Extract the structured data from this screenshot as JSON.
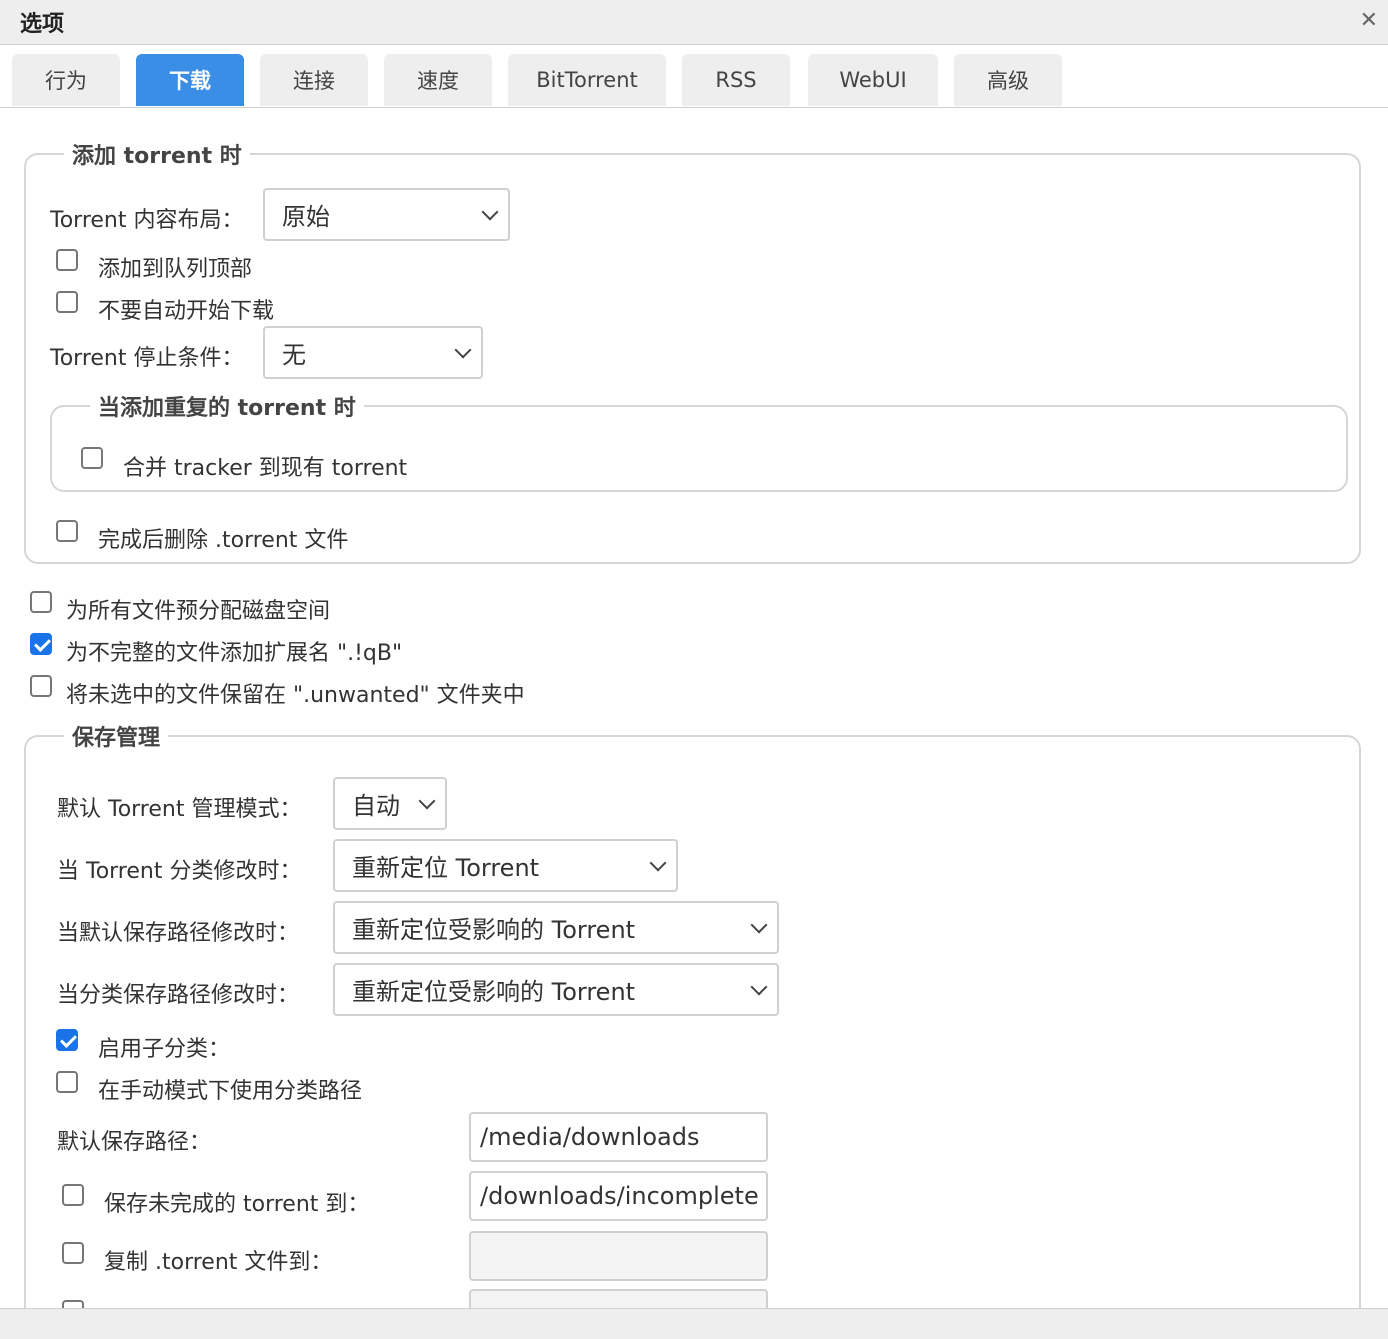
{
  "window": {
    "title": "选项",
    "close_icon": "close-icon"
  },
  "tabs": [
    "行为",
    "下载",
    "连接",
    "速度",
    "BitTorrent",
    "RSS",
    "WebUI",
    "高级"
  ],
  "active_tab": "下载",
  "add_torrent": {
    "legend": "添加 torrent 时",
    "content_layout_label": "Torrent 内容布局：",
    "content_layout_value": "原始",
    "add_to_top_label": "添加到队列顶部",
    "add_to_top_checked": false,
    "dont_start_label": "不要自动开始下载",
    "dont_start_checked": false,
    "stop_condition_label": "Torrent 停止条件：",
    "stop_condition_value": "无",
    "duplicate": {
      "legend": "当添加重复的 torrent 时",
      "merge_trackers_label": "合并 tracker 到现有 torrent",
      "merge_trackers_checked": false
    },
    "delete_torrent_file_label": "完成后删除 .torrent 文件",
    "delete_torrent_file_checked": false
  },
  "preallocate_label": "为所有文件预分配磁盘空间",
  "preallocate_checked": false,
  "append_qb_label": "为不完整的文件添加扩展名 \".!qB\"",
  "append_qb_checked": true,
  "unwanted_folder_label": "将未选中的文件保留在 \".unwanted\" 文件夹中",
  "unwanted_folder_checked": false,
  "save_management": {
    "legend": "保存管理",
    "default_mode_label": "默认 Torrent 管理模式：",
    "default_mode_value": "自动",
    "category_changed_label": "当 Torrent 分类修改时：",
    "category_changed_value": "重新定位 Torrent",
    "default_path_changed_label": "当默认保存路径修改时：",
    "default_path_changed_value": "重新定位受影响的 Torrent",
    "category_path_changed_label": "当分类保存路径修改时：",
    "category_path_changed_value": "重新定位受影响的 Torrent",
    "subcategories_label": "启用子分类：",
    "subcategories_checked": true,
    "manual_category_path_label": "在手动模式下使用分类路径",
    "manual_category_path_checked": false,
    "default_save_path_label": "默认保存路径：",
    "default_save_path_value": "/media/downloads",
    "incomplete_label": "保存未完成的 torrent 到：",
    "incomplete_checked": false,
    "incomplete_value": "/downloads/incomplete",
    "copy_torrent_label": "复制 .torrent 文件到：",
    "copy_torrent_checked": false,
    "copy_torrent_value": ""
  }
}
